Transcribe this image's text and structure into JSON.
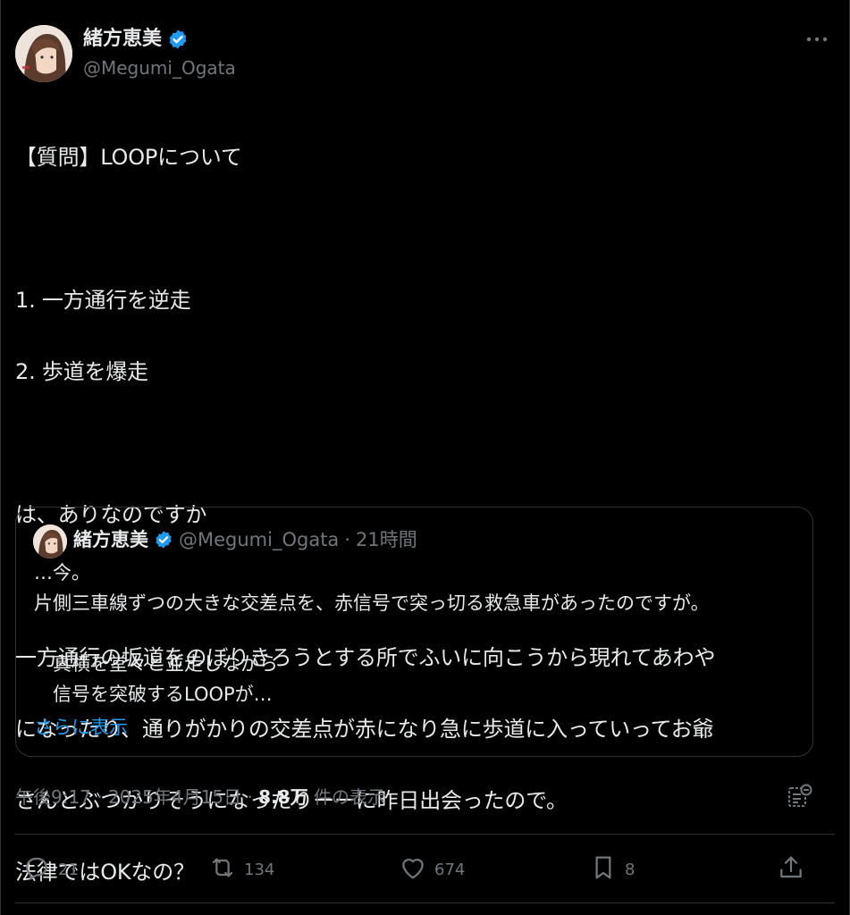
{
  "author": {
    "display_name": "緒方恵美",
    "handle": "@Megumi_Ogata"
  },
  "tweet": {
    "lines": [
      "【質問】LOOPについて",
      "",
      "1. 一方通行を逆走",
      "2. 歩道を爆走",
      "",
      "は、ありなのですか",
      "",
      "一方通行の坂道をのぼりきろうとする所でふいに向こうから現れてあわや",
      "になったり、通りがかりの交差点が赤になり急に歩道に入っていってお爺",
      "さんとぶつかりそうになったりーーに昨日出会ったので。",
      "法律ではOKなの？"
    ]
  },
  "quote": {
    "display_name": "緒方恵美",
    "handle": "@Megumi_Ogata",
    "separator": "·",
    "time": "21時間",
    "lines": [
      "…今。",
      "片側三車線ずつの大きな交差点を、赤信号で突っ切る救急車があったのですが。",
      "",
      "　真横を堂々と並走しながら",
      "　信号を突破するLOOPが…"
    ],
    "show_more": "さらに表示"
  },
  "meta": {
    "time": "午後9:17",
    "sep1": "·",
    "date": "2025年4月15日",
    "sep2": "·",
    "views_count": "8.8万",
    "views_label": "件の表示"
  },
  "actions": {
    "replies": "21",
    "retweets": "134",
    "likes": "674",
    "bookmarks": "8"
  },
  "colors": {
    "background": "#000000",
    "text": "#e7e9ea",
    "muted": "#71767b",
    "accent": "#1d9bf0",
    "border": "#2f3336"
  },
  "icons": [
    "verified-badge-icon",
    "more-icon",
    "analytics-icon",
    "reply-icon",
    "retweet-icon",
    "like-icon",
    "bookmark-icon",
    "share-icon"
  ]
}
